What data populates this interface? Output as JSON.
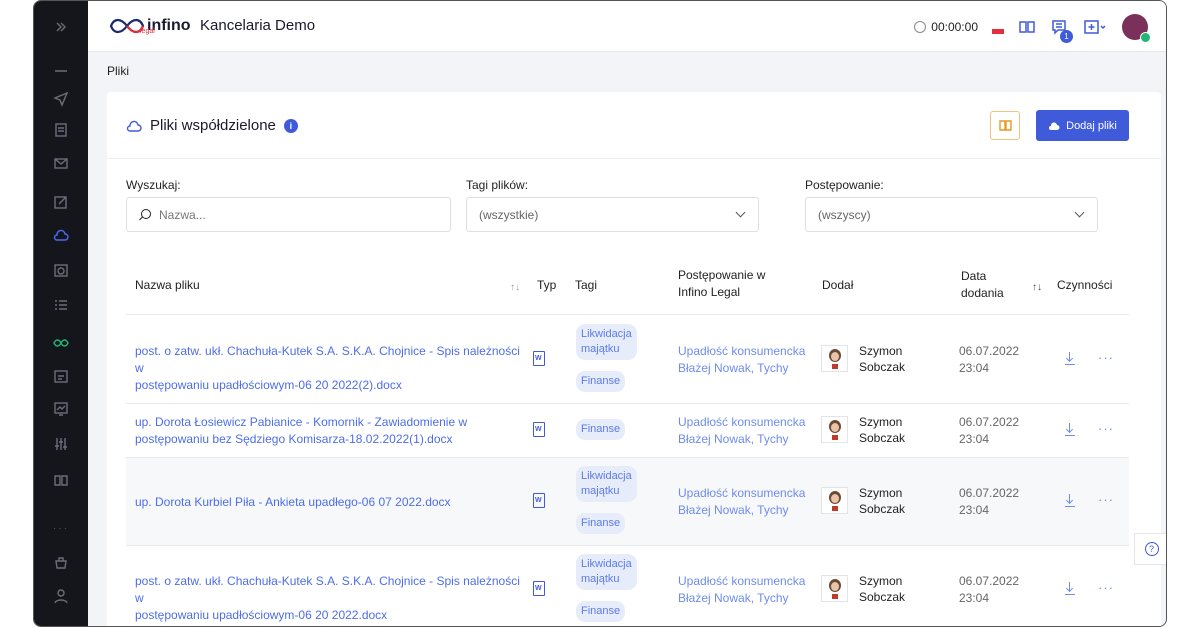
{
  "app": {
    "brand": "infino",
    "brand_sub": "legal",
    "title": "Kancelaria Demo"
  },
  "topbar": {
    "timer": "00:00:00",
    "notifications_count": "1"
  },
  "breadcrumb": "Pliki",
  "card": {
    "title": "Pliki współdzielone",
    "add_button": "Dodaj pliki"
  },
  "filters": {
    "search_label": "Wyszukaj:",
    "search_placeholder": "Nazwa...",
    "tags_label": "Tagi plików:",
    "tags_value": "(wszystkie)",
    "proc_label": "Postępowanie:",
    "proc_value": "(wszyscy)"
  },
  "table": {
    "headers": {
      "name": "Nazwa pliku",
      "type": "Typ",
      "tags": "Tagi",
      "proc_line1": "Postępowanie w",
      "proc_line2": "Infino Legal",
      "added_by": "Dodał",
      "date_line1": "Data",
      "date_line2": "dodania",
      "actions": "Czynności"
    },
    "rows": [
      {
        "name_line1": "post. o zatw. ukł. Chachuła-Kutek S.A. S.K.A. Chojnice - Spis należności w",
        "name_line2": "postępowaniu upadłościowym-06 20 2022(2).docx",
        "tag1_line1": "Likwidacja",
        "tag1_line2": "majątku",
        "tag2": "Finanse",
        "proc_line1": "Upadłość konsumencka",
        "proc_line2": "Błażej Nowak, Tychy",
        "user_first": "Szymon",
        "user_last": "Sobczak",
        "date": "06.07.2022",
        "time": "23:04"
      },
      {
        "name_line1": "up. Dorota Łosiewicz Pabianice - Komornik - Zawiadomienie w",
        "name_line2": "postępowaniu bez Sędziego Komisarza-18.02.2022(1).docx",
        "tag2": "Finanse",
        "proc_line1": "Upadłość konsumencka",
        "proc_line2": "Błażej Nowak, Tychy",
        "user_first": "Szymon",
        "user_last": "Sobczak",
        "date": "06.07.2022",
        "time": "23:04"
      },
      {
        "name_line1": "up. Dorota Kurbiel Piła - Ankieta upadłego-06 07 2022.docx",
        "tag1_line1": "Likwidacja",
        "tag1_line2": "majątku",
        "tag2": "Finanse",
        "proc_line1": "Upadłość konsumencka",
        "proc_line2": "Błażej Nowak, Tychy",
        "user_first": "Szymon",
        "user_last": "Sobczak",
        "date": "06.07.2022",
        "time": "23:04"
      },
      {
        "name_line1": "post. o zatw. ukł. Chachuła-Kutek S.A. S.K.A. Chojnice - Spis należności w",
        "name_line2": "postępowaniu upadłościowym-06 20 2022.docx",
        "tag1_line1": "Likwidacja",
        "tag1_line2": "majątku",
        "tag2": "Finanse",
        "proc_line1": "Upadłość konsumencka",
        "proc_line2": "Błażej Nowak, Tychy",
        "user_first": "Szymon",
        "user_last": "Sobczak",
        "date": "06.07.2022",
        "time": "23:04"
      }
    ]
  },
  "help": "?",
  "colors": {
    "accent": "#3f5bd9",
    "sidebar": "#15161c",
    "link": "#4e6de8",
    "tag_bg": "#e7ecfb"
  }
}
